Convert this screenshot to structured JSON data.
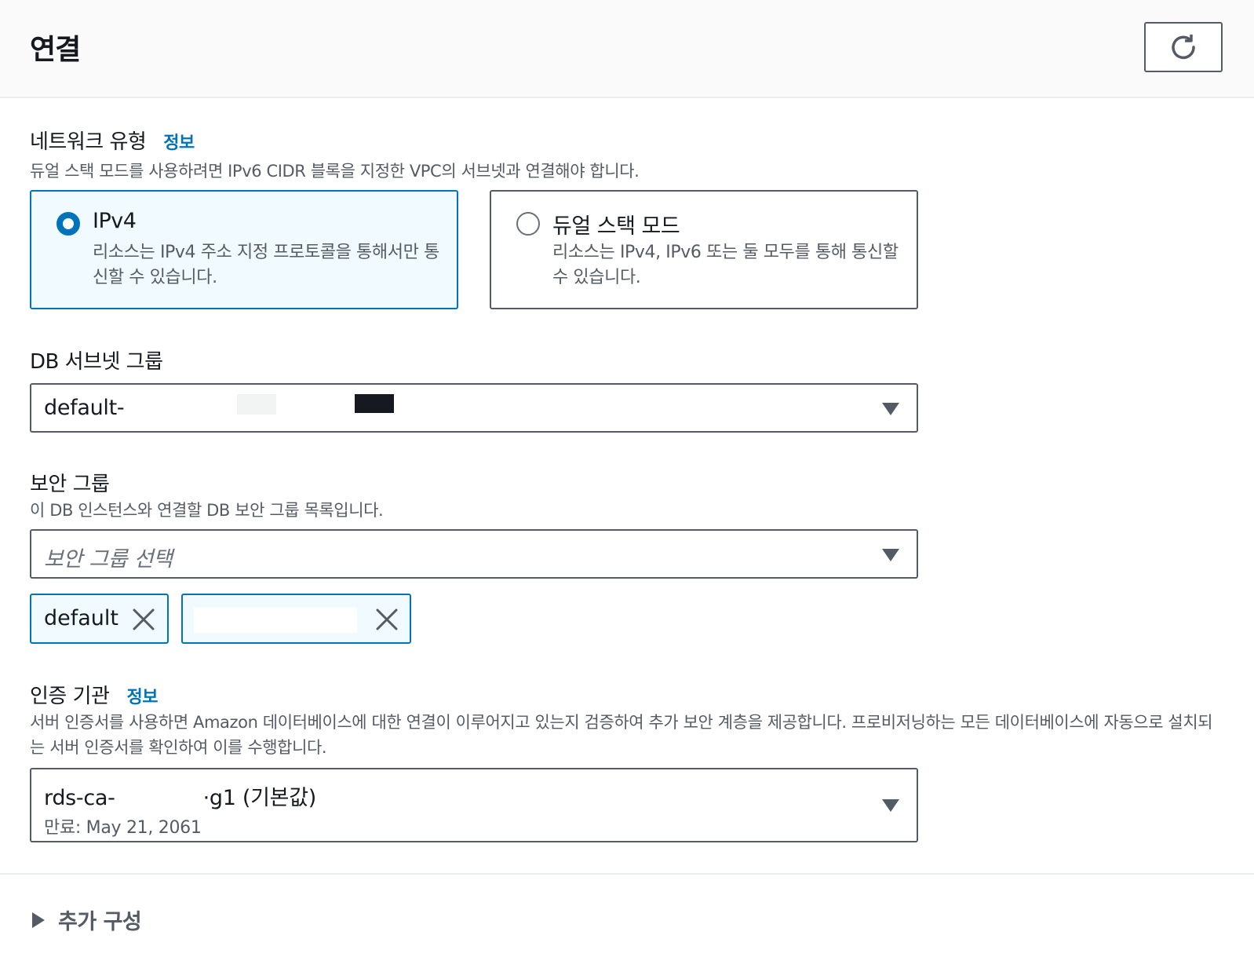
{
  "header": {
    "title": "연결",
    "refresh_icon": "refresh-icon"
  },
  "network_type": {
    "label": "네트워크 유형",
    "info": "정보",
    "description": "듀얼 스택 모드를 사용하려면 IPv6 CIDR 블록을 지정한 VPC의 서브넷과 연결해야 합니다.",
    "options": [
      {
        "title": "IPv4",
        "description": "리소스는 IPv4 주소 지정 프로토콜을 통해서만 통신할 수 있습니다.",
        "selected": true
      },
      {
        "title": "듀얼 스택 모드",
        "description": "리소스는 IPv4, IPv6 또는 둘 모두를 통해 통신할 수 있습니다.",
        "selected": false
      }
    ]
  },
  "subnet_group": {
    "label": "DB 서브넷 그룹",
    "value": "default-"
  },
  "security_group": {
    "label": "보안 그룹",
    "description": "이 DB 인스턴스와 연결할 DB 보안 그룹 목록입니다.",
    "placeholder": "보안 그룹 선택",
    "tokens": [
      {
        "label": "default"
      },
      {
        "label": ""
      }
    ]
  },
  "certificate_authority": {
    "label": "인증 기관",
    "info": "정보",
    "description": "서버 인증서를 사용하면 Amazon 데이터베이스에 대한 연결이 이루어지고 있는지 검증하여 추가 보안 계층을 제공합니다. 프로비저닝하는 모든 데이터베이스에 자동으로 설치되는 서버 인증서를 확인하여 이를 수행합니다.",
    "value_prefix": "rds-ca-",
    "value_suffix": "·g1 (기본값)",
    "expiry": "만료: May 21, 2061"
  },
  "additional_config": {
    "label": "추가 구성"
  },
  "colors": {
    "accent": "#0073bb",
    "selected_bg": "#f1faff",
    "border": "#545b64"
  }
}
